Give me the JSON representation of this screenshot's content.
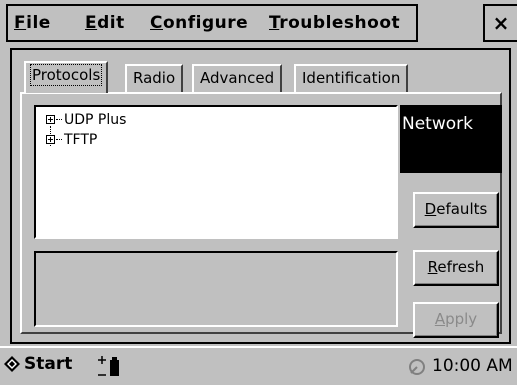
{
  "menu": {
    "file": {
      "accel": "F",
      "rest": "ile"
    },
    "edit": {
      "accel": "E",
      "rest": "dit"
    },
    "configure": {
      "accel": "C",
      "rest": "onfigure"
    },
    "troubleshoot": {
      "accel": "T",
      "rest": "roubleshoot"
    },
    "close": "×"
  },
  "tabs": [
    "Protocols",
    "Radio",
    "Advanced",
    "Identification"
  ],
  "active_tab": "Protocols",
  "tree": [
    {
      "label": "UDP Plus",
      "expander": "+"
    },
    {
      "label": "TFTP",
      "expander": "+"
    }
  ],
  "side_label": "Network",
  "buttons": {
    "defaults": {
      "accel": "D",
      "rest": "efaults",
      "enabled": true
    },
    "refresh": {
      "accel": "R",
      "rest": "efresh",
      "enabled": true
    },
    "apply": {
      "accel": "A",
      "rest": "pply",
      "enabled": false
    }
  },
  "taskbar": {
    "start_label": "Start",
    "clock": "10:00 AM"
  }
}
